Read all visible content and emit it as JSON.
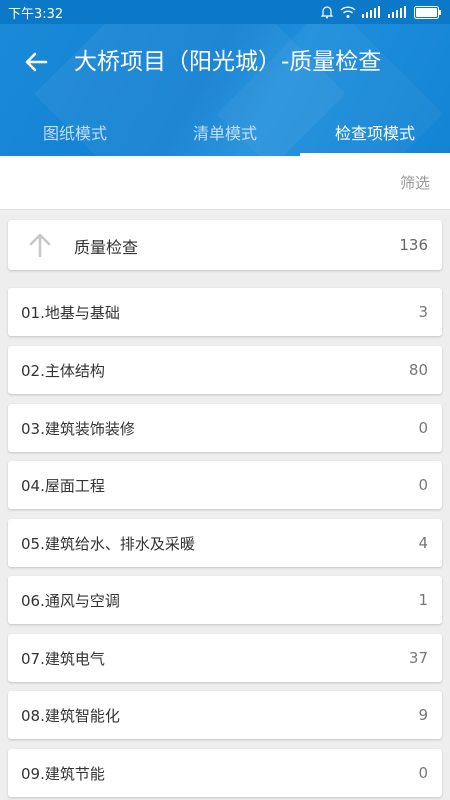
{
  "status_bar": {
    "time": "下午3:32",
    "icons": [
      "alarm-icon",
      "wifi-icon",
      "signal-icon",
      "signal-icon",
      "battery-icon"
    ]
  },
  "header": {
    "title": "大桥项目（阳光城）-质量检查",
    "back_icon": "arrow-left-icon",
    "tabs": [
      {
        "label": "图纸模式",
        "active": false
      },
      {
        "label": "清单模式",
        "active": false
      },
      {
        "label": "检查项模式",
        "active": true
      }
    ]
  },
  "filter": {
    "label": "筛选"
  },
  "parent": {
    "label": "质量检查",
    "count": "136",
    "icon": "arrow-up-icon"
  },
  "items": [
    {
      "label": "01.地基与基础",
      "count": "3"
    },
    {
      "label": "02.主体结构",
      "count": "80"
    },
    {
      "label": "03.建筑装饰装修",
      "count": "0"
    },
    {
      "label": "04.屋面工程",
      "count": "0"
    },
    {
      "label": "05.建筑给水、排水及采暖",
      "count": "4"
    },
    {
      "label": "06.通风与空调",
      "count": "1"
    },
    {
      "label": "07.建筑电气",
      "count": "37"
    },
    {
      "label": "08.建筑智能化",
      "count": "9"
    },
    {
      "label": "09.建筑节能",
      "count": "0"
    }
  ],
  "colors": {
    "primary": "#1380d2",
    "status_bar": "#0c78c8",
    "background": "#eeeeee"
  }
}
